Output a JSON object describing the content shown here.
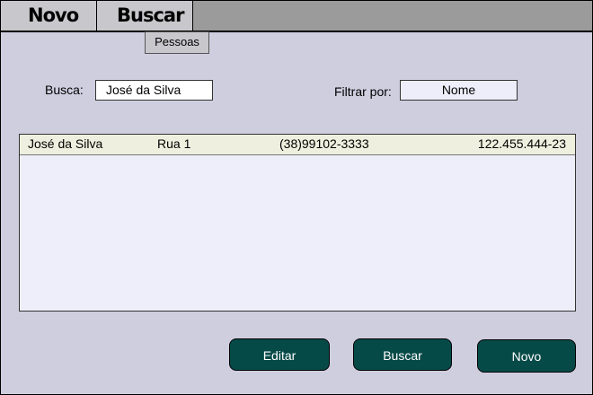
{
  "tabs": [
    {
      "label": "Novo"
    },
    {
      "label": "Buscar"
    }
  ],
  "subtab": {
    "label": "Pessoas"
  },
  "search": {
    "label": "Busca:",
    "value": "José da Silva"
  },
  "filter": {
    "label": "Filtrar por:",
    "value": "Nome"
  },
  "results": {
    "rows": [
      {
        "nome": "José da Silva",
        "rua": "Rua 1",
        "telefone": "(38)99102-3333",
        "cpf": "122.455.444-23"
      }
    ]
  },
  "buttons": {
    "editar": "Editar",
    "buscar": "Buscar",
    "novo": "Novo"
  },
  "colors": {
    "window_bg": "#cfcedf",
    "tabbar_bg": "#9b9b9b",
    "button_bg": "#064a48",
    "list_bg": "#eeeefa",
    "row_bg": "#efefdf"
  }
}
